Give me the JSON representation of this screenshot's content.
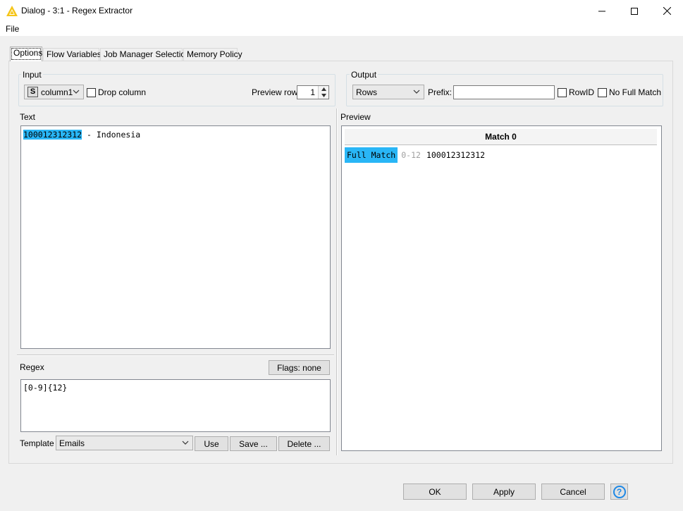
{
  "window": {
    "title": "Dialog - 3:1 - Regex Extractor",
    "controls": [
      "minimize-icon",
      "maximize-icon",
      "close-icon"
    ]
  },
  "menu": {
    "file": "File"
  },
  "tabs": [
    {
      "label": "Options",
      "active": true
    },
    {
      "label": "Flow Variables"
    },
    {
      "label": "Job Manager Selection"
    },
    {
      "label": "Memory Policy"
    }
  ],
  "input": {
    "legend": "Input",
    "column_type_badge": "S",
    "column": "column1",
    "drop_column_label": "Drop column",
    "preview_row_label": "Preview row:",
    "preview_row_value": "1"
  },
  "output": {
    "legend": "Output",
    "mode": "Rows",
    "prefix_label": "Prefix:",
    "prefix_value": "",
    "rowid_label": "RowID",
    "no_full_match_label": "No Full Match"
  },
  "text_section": {
    "label": "Text",
    "highlighted": "100012312312",
    "rest": " - Indonesia"
  },
  "regex_section": {
    "label": "Regex",
    "flags_button": "Flags: none",
    "pattern": "[0-9]{12}"
  },
  "template": {
    "label": "Template",
    "selected": "Emails",
    "use_button": "Use",
    "save_button": "Save ...",
    "delete_button": "Delete ..."
  },
  "preview": {
    "label": "Preview",
    "header": "Match 0",
    "rows": [
      {
        "group": "Full Match",
        "range": "0-12",
        "value": "100012312312"
      }
    ]
  },
  "footer": {
    "ok": "OK",
    "apply": "Apply",
    "cancel": "Cancel",
    "help_icon": "?"
  },
  "colors": {
    "highlight": "#29b6f6",
    "app_icon": "#f5c518"
  }
}
